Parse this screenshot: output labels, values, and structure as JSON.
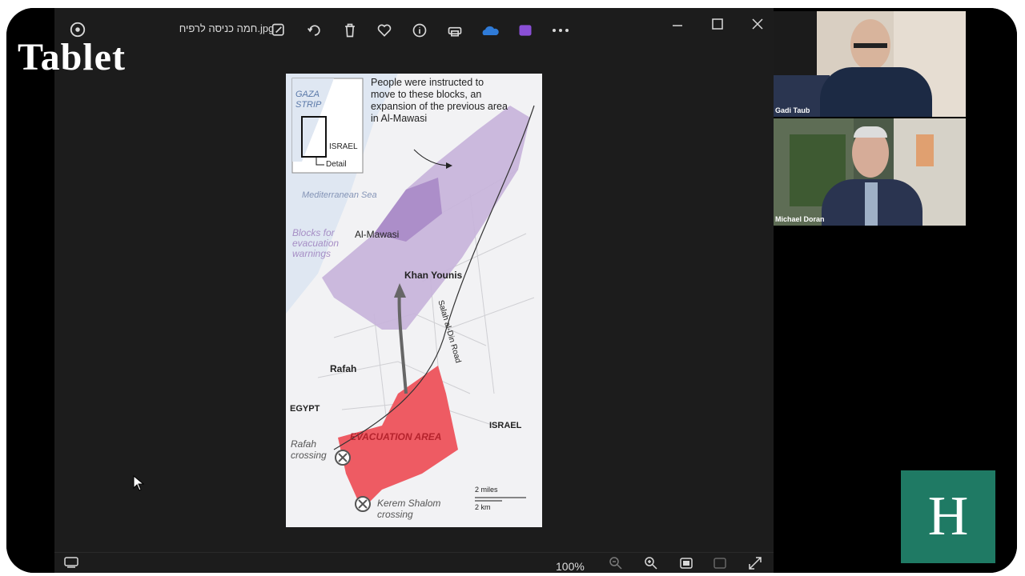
{
  "viewer": {
    "file_name": "חמה כניסה לרפיח.jpg",
    "zoom_level": "100%",
    "toolbar_icons": [
      "edit-icon",
      "rotate-icon",
      "delete-icon",
      "favorite-icon",
      "info-icon",
      "print-icon",
      "onedrive-icon",
      "clipchamp-icon",
      "more-icon"
    ],
    "window_controls": [
      "minimize-icon",
      "maximize-icon",
      "close-icon"
    ]
  },
  "overlay": {
    "tablet_logo": "Tablet",
    "h_logo": "H"
  },
  "map": {
    "inset_label_1": "GAZA",
    "inset_label_2": "STRIP",
    "inset_label_3": "ISRAEL",
    "inset_label_4": "Detail",
    "note": "People were instructed to move to these blocks, an expansion of the previous area in Al-Mawasi",
    "sea_label": "Mediterranean Sea",
    "blocks_label": "Blocks for evacuation warnings",
    "al_mawasi": "Al-Mawasi",
    "khan_younis": "Khan Younis",
    "salah_road": "Salah al-Din Road",
    "rafah": "Rafah",
    "egypt": "EGYPT",
    "israel": "ISRAEL",
    "evacuation_area": "EVACUATION AREA",
    "rafah_crossing": "Rafah crossing",
    "kerem_shalom": "Kerem Shalom crossing",
    "scale_miles": "2 miles",
    "scale_km": "2 km"
  },
  "participants": [
    {
      "name": "Gadi Taub"
    },
    {
      "name": "Michael Doran"
    }
  ],
  "colors": {
    "evacuation_red": "#ee5b63",
    "purple_blocks": "#b79ccc",
    "teal_logo": "#1f7a64"
  }
}
